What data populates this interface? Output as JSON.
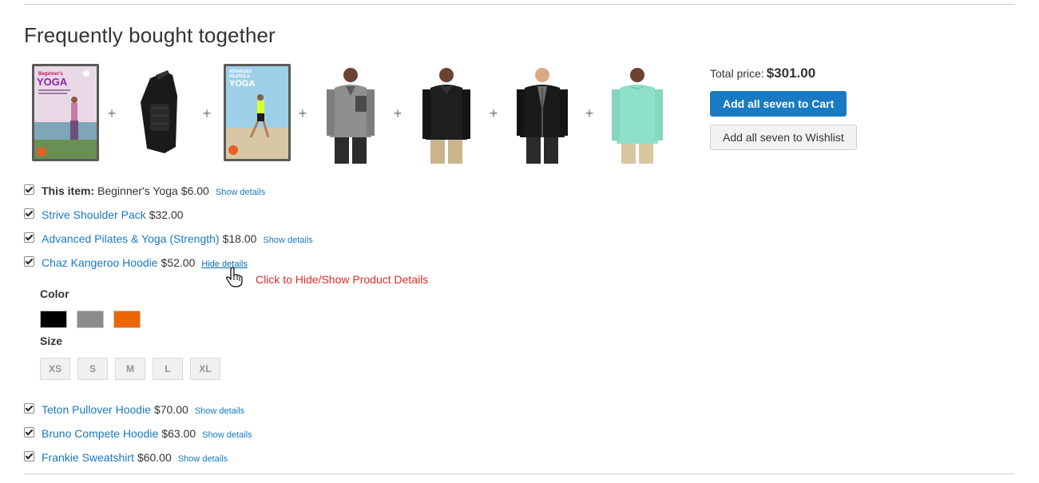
{
  "heading": "Frequently bought together",
  "summary": {
    "total_label": "Total price:",
    "total_amount": "$301.00",
    "add_cart_label": "Add all seven to Cart",
    "add_wishlist_label": "Add all seven to Wishlist"
  },
  "thumbnails": [
    {
      "caption": "Beginner's YOGA"
    },
    {
      "caption": ""
    },
    {
      "caption": "ADVANCED PILATES & YOGA"
    },
    {
      "caption": ""
    },
    {
      "caption": ""
    },
    {
      "caption": ""
    },
    {
      "caption": ""
    }
  ],
  "plus_sign": "+",
  "items": [
    {
      "prefix": "This item:",
      "name": "Beginner's Yoga",
      "price": "$6.00",
      "details": "Show details"
    },
    {
      "name": "Strive Shoulder Pack",
      "price": "$32.00",
      "details": ""
    },
    {
      "name": "Advanced Pilates & Yoga (Strength)",
      "price": "$18.00",
      "details": "Show details"
    },
    {
      "name": "Chaz Kangeroo Hoodie",
      "price": "$52.00",
      "details": "Hide details"
    },
    {
      "name": "Teton Pullover Hoodie",
      "price": "$70.00",
      "details": "Show details"
    },
    {
      "name": "Bruno Compete Hoodie",
      "price": "$63.00",
      "details": "Show details"
    },
    {
      "name": "Frankie Sweatshirt",
      "price": "$60.00",
      "details": "Show details"
    }
  ],
  "annotation": "Click to Hide/Show Product Details",
  "options": {
    "color_label": "Color",
    "colors": [
      "#000000",
      "#8c8c8c",
      "#eb6703"
    ],
    "size_label": "Size",
    "sizes": [
      "XS",
      "S",
      "M",
      "L",
      "XL"
    ]
  },
  "colors": {
    "accent": "#1979c3",
    "annotation": "#e02b27"
  }
}
